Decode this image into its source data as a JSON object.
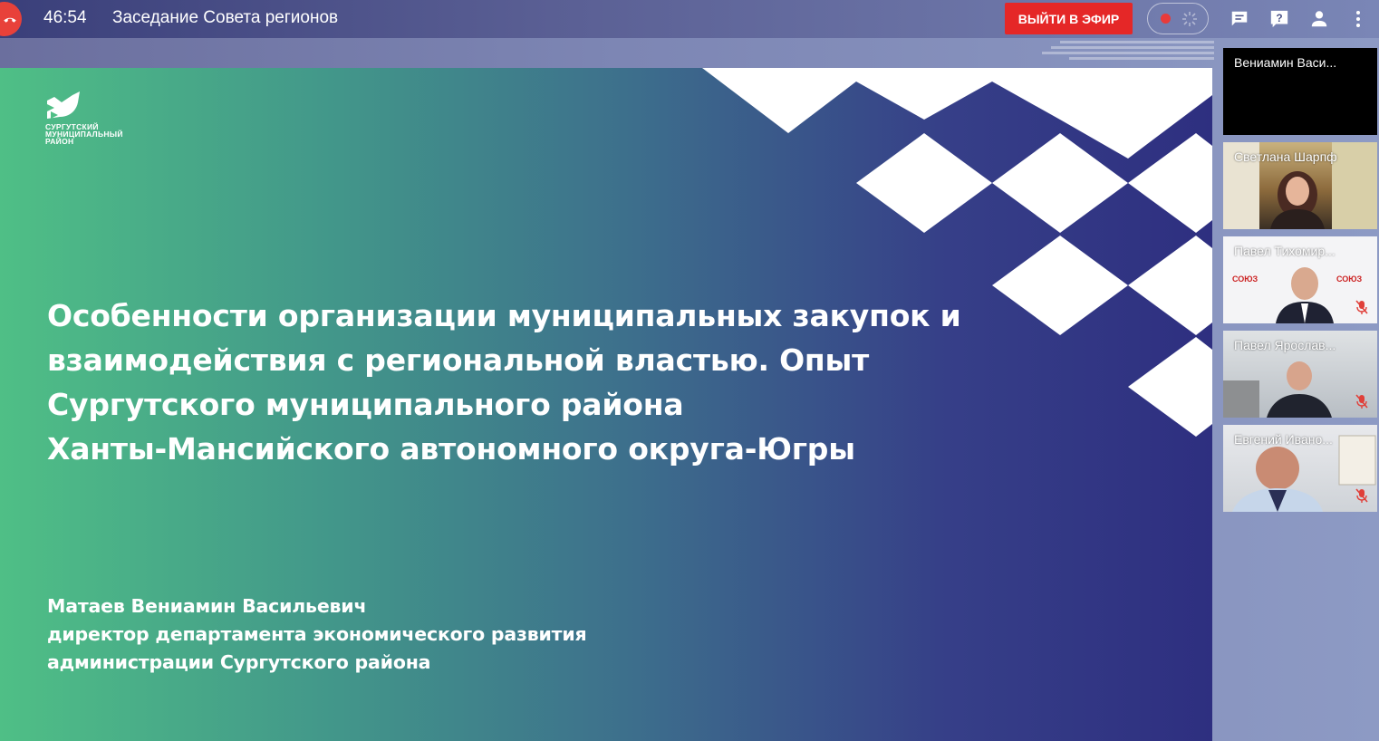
{
  "call": {
    "timer": "46:54",
    "title": "Заседание Совета регионов",
    "go_live_label": "ВЫЙТИ В ЭФИР"
  },
  "toolbar_icons": [
    "hangup-icon",
    "record-icon",
    "chat-icon",
    "help-icon",
    "participants-icon",
    "more-icon"
  ],
  "slide": {
    "logo_lines": [
      "СУРГУТСКИЙ",
      "МУНИЦИПАЛЬНЫЙ",
      "РАЙОН"
    ],
    "title_lines": [
      "Особенности организации муниципальных закупок и",
      "взаимодействия с региональной властью.  Опыт",
      "Сургутского муниципального района",
      "Ханты-Мансийского автономного округа-Югры"
    ],
    "author_lines": [
      "Матаев Вениамин Васильевич",
      "директор департамента экономического развития",
      "администрации Сургутского района"
    ]
  },
  "participants": [
    {
      "name": "Вениамин Васи...",
      "muted": false
    },
    {
      "name": "Светлана Шарпф",
      "muted": false
    },
    {
      "name": "Павел Тихомир...",
      "muted": true
    },
    {
      "name": "Павел Ярослав...",
      "muted": true
    },
    {
      "name": "Евгений Ивано...",
      "muted": true
    }
  ],
  "colors": {
    "accent_red": "#e52727",
    "slide_green": "#4fbf86",
    "slide_indigo": "#2e2f80"
  }
}
